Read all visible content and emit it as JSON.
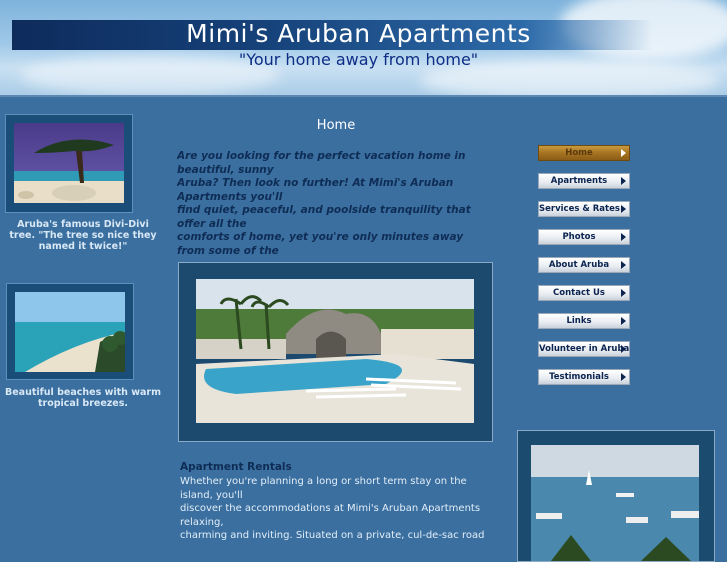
{
  "header": {
    "title": "Mimi's Aruban Apartments",
    "tagline": "\"Your home away from home\""
  },
  "sidebar_left": {
    "captions": [
      "Aruba's famous Divi-Divi tree. \"The tree so nice they named it twice!\"",
      "Beautiful beaches with warm tropical breezes."
    ]
  },
  "main": {
    "heading": "Home",
    "intro_lines": [
      "Are you looking for the perfect vacation home in beautiful, sunny",
      "Aruba?  Then look no further!  At Mimi's Aruban Apartments you'll",
      "find quiet, peaceful, and poolside tranquility that offer all the",
      "comforts of home, yet you're only minutes away from some of the"
    ],
    "rentals_heading": "Apartment Rentals",
    "rentals_lines": [
      "Whether you're planning a long or short term stay on the island, you'll",
      "discover the accommodations at Mimi's Aruban Apartments relaxing,",
      "charming and inviting.  Situated on a private, cul-de-sac road"
    ]
  },
  "nav": {
    "items": [
      {
        "label": "Home",
        "active": true
      },
      {
        "label": "Apartments"
      },
      {
        "label": "Services & Rates"
      },
      {
        "label": "Photos"
      },
      {
        "label": "About Aruba"
      },
      {
        "label": "Contact Us"
      },
      {
        "label": "Links"
      },
      {
        "label": "Volunteer in Aruba"
      },
      {
        "label": "Testimonials"
      }
    ]
  },
  "colors": {
    "page_bg": "#3a6fa0",
    "title_bar": "#16427a",
    "nav_active": "#a77321"
  }
}
